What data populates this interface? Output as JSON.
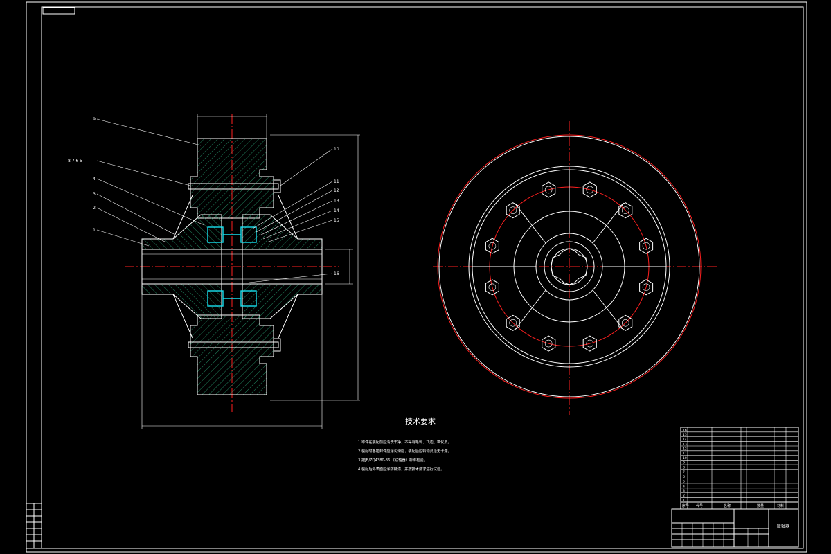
{
  "title_corner_label": "",
  "leader_labels": {
    "l9": "9",
    "l8765": "8  7  6  5",
    "l4": "4",
    "l3": "3",
    "l2": "2",
    "l1": "1",
    "r10": "10",
    "r11": "11",
    "r12": "12",
    "r13": "13",
    "r14": "14",
    "r15": "15",
    "r16": "16"
  },
  "tech_req": {
    "heading": "技术要求",
    "lines": [
      "1.零件在装配前应清洗干净，不得有毛刺、飞边、氧化皮。",
      "2.装配时各密封件应涂润滑脂，装配后应转动灵活无卡滞。",
      "3.按JB/ZQ4380-86 《联轴器》标准检验。",
      "4.装配后外表面应涂防锈漆，并按技术要求进行试验。"
    ]
  },
  "parts_table": {
    "rows": [
      [
        "16",
        "",
        "",
        "",
        ""
      ],
      [
        "15",
        "",
        "",
        "",
        ""
      ],
      [
        "14",
        "",
        "",
        "",
        ""
      ],
      [
        "13",
        "",
        "",
        "",
        ""
      ],
      [
        "12",
        "",
        "",
        "",
        ""
      ],
      [
        "11",
        "",
        "",
        "",
        ""
      ],
      [
        "10",
        "",
        "",
        "",
        ""
      ],
      [
        "9",
        "",
        "",
        "",
        ""
      ],
      [
        "8",
        "",
        "",
        "",
        ""
      ],
      [
        "7",
        "",
        "",
        "",
        ""
      ],
      [
        "6",
        "",
        "",
        "",
        ""
      ],
      [
        "5",
        "",
        "",
        "",
        ""
      ],
      [
        "4",
        "",
        "",
        "",
        ""
      ],
      [
        "3",
        "",
        "",
        "",
        ""
      ],
      [
        "2",
        "",
        "",
        "",
        ""
      ],
      [
        "1",
        "",
        "",
        "",
        ""
      ]
    ],
    "header": [
      "序号",
      "代号",
      "名称",
      "数量",
      "材料"
    ],
    "drawing_title": "联轴器"
  }
}
